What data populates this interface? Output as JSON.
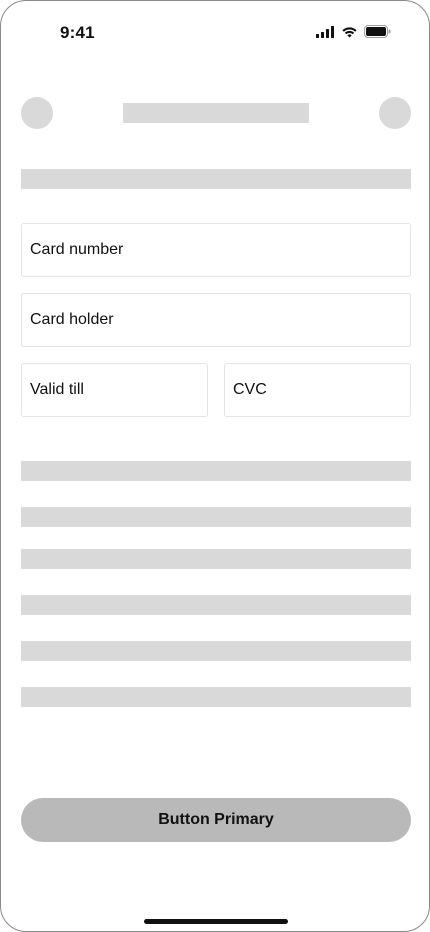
{
  "status_bar": {
    "time": "9:41",
    "icons": [
      "cellular-signal-icon",
      "wifi-icon",
      "battery-icon"
    ]
  },
  "form": {
    "card_number": {
      "placeholder": "Card number"
    },
    "card_holder": {
      "placeholder": "Card holder"
    },
    "valid_till": {
      "placeholder": "Valid till"
    },
    "cvc": {
      "placeholder": "CVC"
    }
  },
  "actions": {
    "primary_label": "Button Primary"
  },
  "colors": {
    "placeholder_block": "#d9d9d9",
    "button_background": "#b9b9b9",
    "field_border": "#e4e4e4"
  }
}
